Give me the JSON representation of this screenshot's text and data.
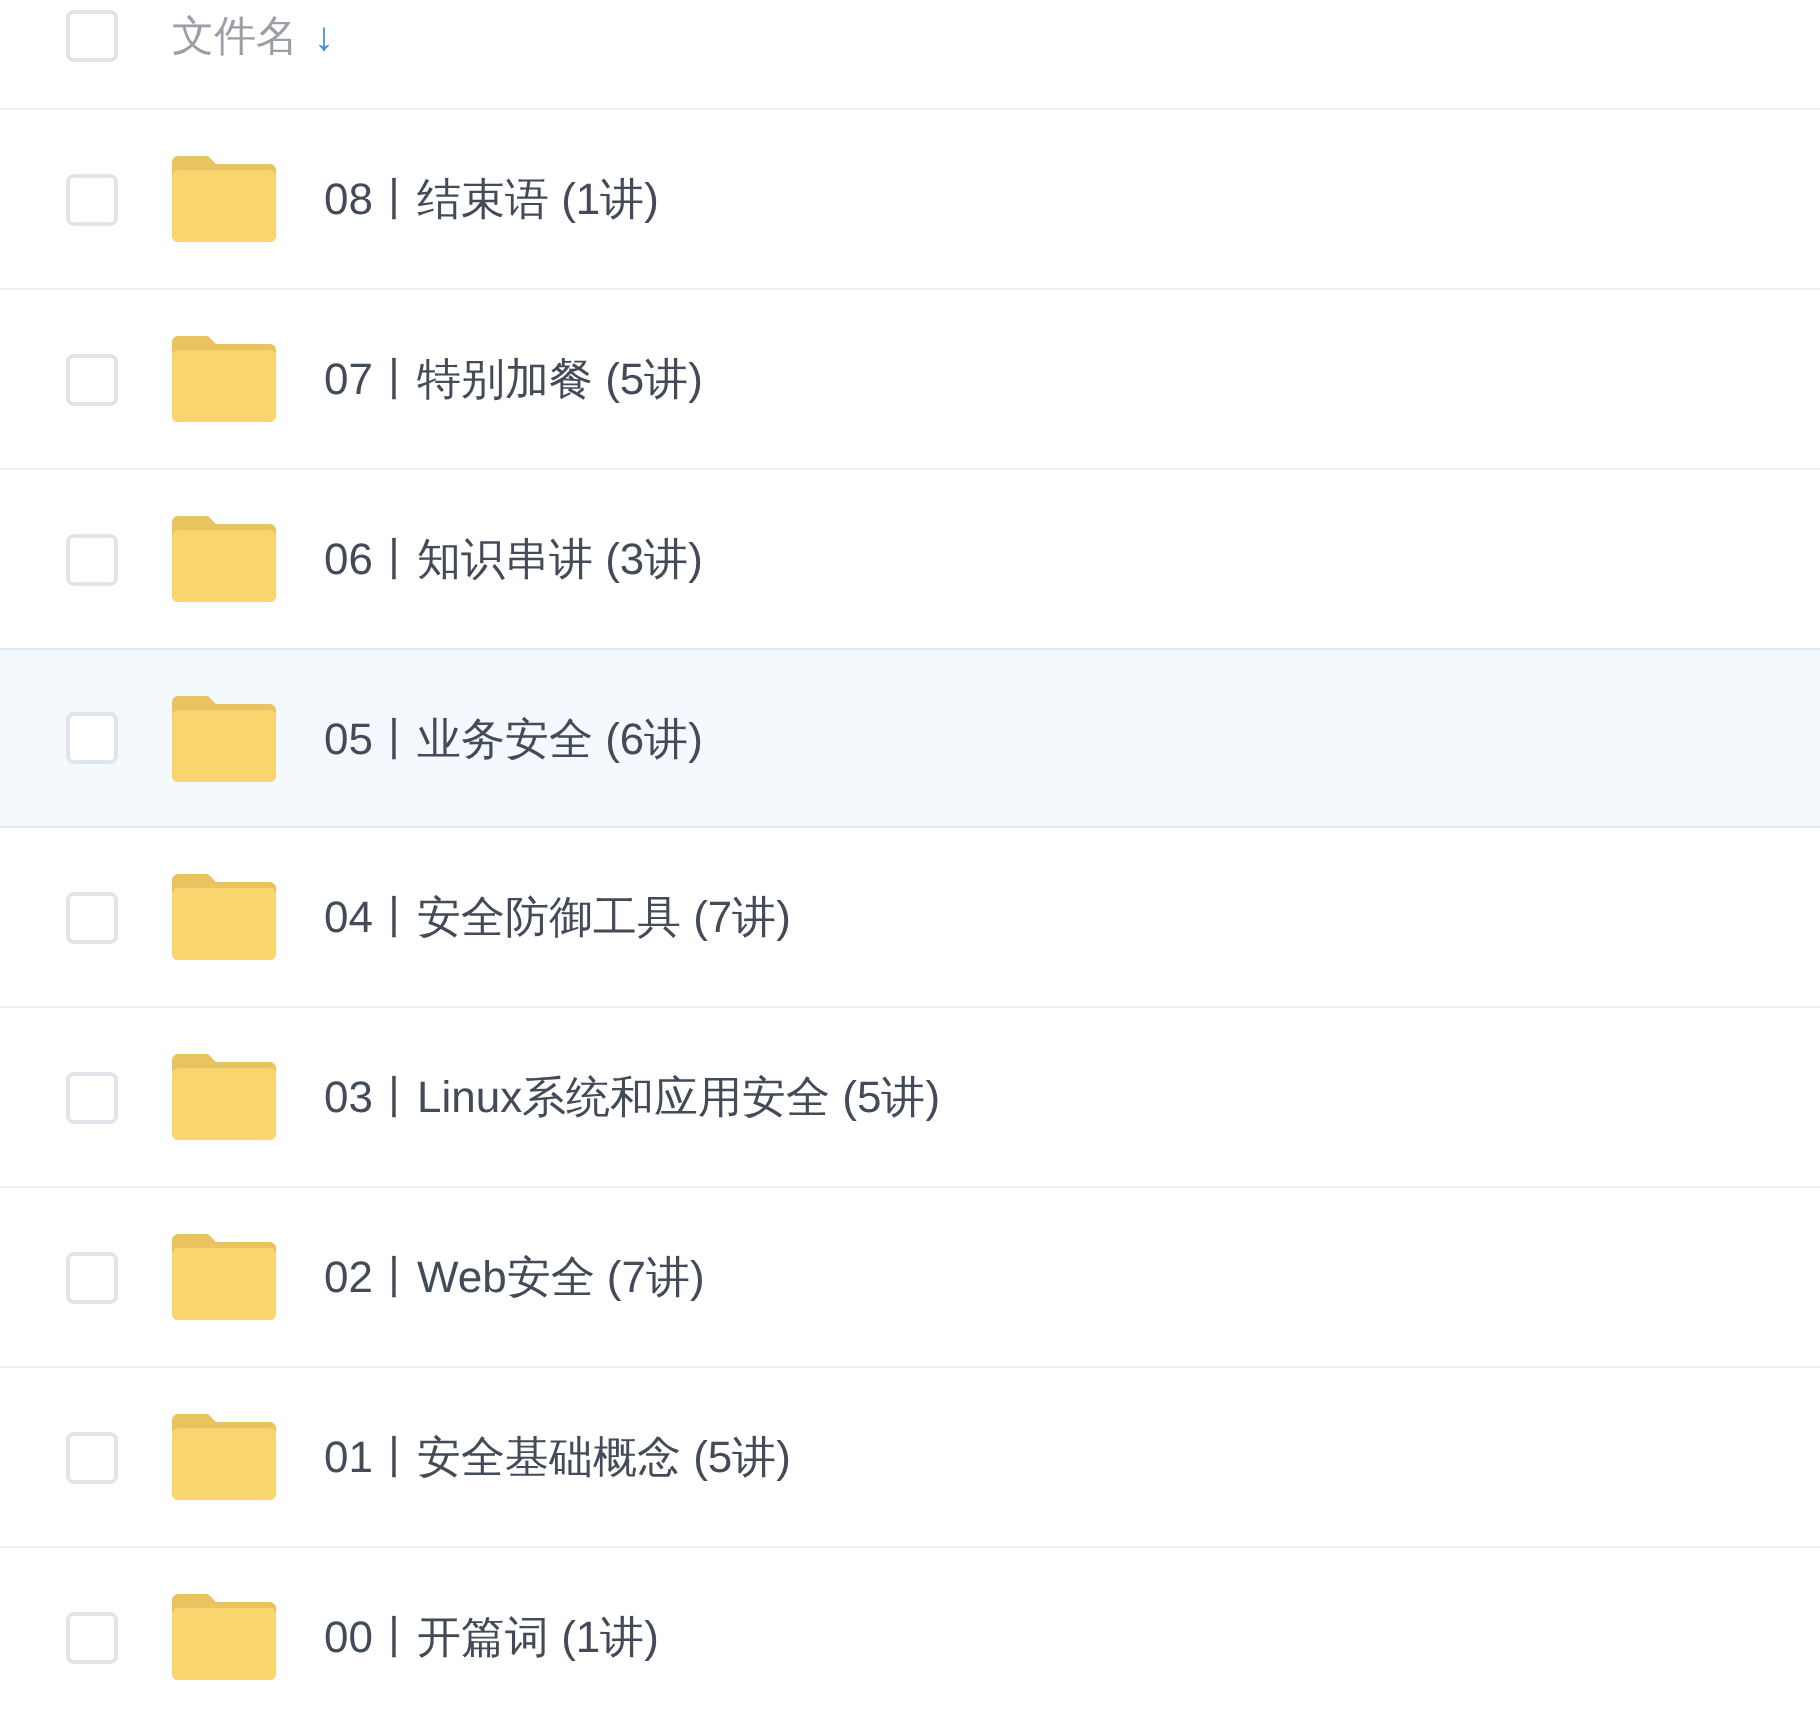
{
  "header": {
    "label": "文件名",
    "sort_arrow": "↓",
    "checked": false
  },
  "rows": [
    {
      "name": "08丨结束语 (1讲)",
      "selected": false,
      "checked": false
    },
    {
      "name": "07丨特别加餐 (5讲)",
      "selected": false,
      "checked": false
    },
    {
      "name": "06丨知识串讲 (3讲)",
      "selected": false,
      "checked": false
    },
    {
      "name": "05丨业务安全 (6讲)",
      "selected": true,
      "checked": false
    },
    {
      "name": "04丨安全防御工具 (7讲)",
      "selected": false,
      "checked": false
    },
    {
      "name": "03丨Linux系统和应用安全 (5讲)",
      "selected": false,
      "checked": false
    },
    {
      "name": "02丨Web安全 (7讲)",
      "selected": false,
      "checked": false
    },
    {
      "name": "01丨安全基础概念 (5讲)",
      "selected": false,
      "checked": false
    },
    {
      "name": "00丨开篇词 (1讲)",
      "selected": false,
      "checked": false
    }
  ]
}
